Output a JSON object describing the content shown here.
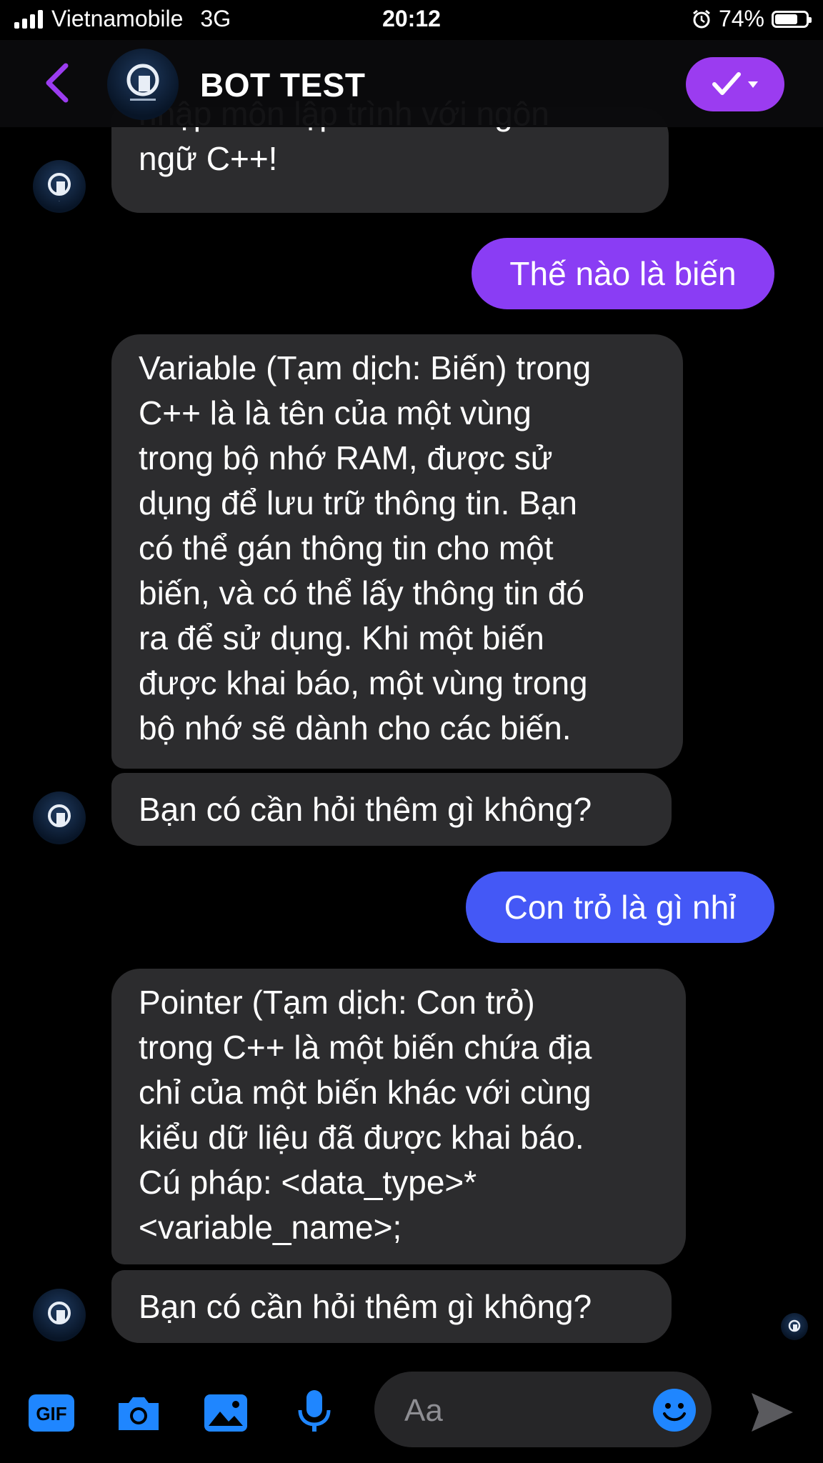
{
  "status_bar": {
    "carrier": "Vietnamobile",
    "network": "3G",
    "time": "20:12",
    "battery": "74%",
    "battery_level": 0.74
  },
  "header": {
    "title": "BOT TEST"
  },
  "messages": [
    {
      "from": "bot",
      "text": "nhập môn lập trình với ngôn"
    },
    {
      "from": "bot",
      "text": "ngữ C++!"
    },
    {
      "from": "user",
      "text": "Thế nào là biến"
    },
    {
      "from": "bot",
      "lines": [
        "Variable (Tạm dịch: Biến) trong",
        "C++ là là tên của một vùng",
        "trong bộ nhớ RAM, được sử",
        "dụng để lưu trữ thông tin. Bạn",
        "có thể gán thông tin cho một",
        "biến, và có thể lấy thông tin đó",
        "ra để sử dụng. Khi một biến",
        "được khai báo, một vùng trong",
        "bộ nhớ sẽ dành cho các biến."
      ]
    },
    {
      "from": "bot",
      "text": "Bạn có cần hỏi thêm gì không?"
    },
    {
      "from": "user",
      "text": "Con trỏ là gì nhỉ"
    },
    {
      "from": "bot",
      "lines": [
        "Pointer (Tạm dịch: Con trỏ)",
        "trong C++ là một biến chứa địa",
        "chỉ của một biến khác với cùng",
        "kiểu dữ liệu đã được khai báo.",
        "Cú pháp: <data_type>*",
        "<variable_name>;"
      ]
    },
    {
      "from": "bot",
      "text": "Bạn có cần hỏi thêm gì không?"
    }
  ],
  "composer": {
    "placeholder": "Aa",
    "gif_label": "GIF"
  },
  "colors": {
    "accent_purple": "#9b3cf0",
    "user_bubble_1": "#8a3df4",
    "user_bubble_2": "#4458f6",
    "bot_bubble": "#2c2c2e",
    "tool_blue": "#1f86ff"
  },
  "icons": [
    "signal-icon",
    "alarm-icon",
    "battery-icon",
    "back-arrow-icon",
    "bot-avatar",
    "checkmark-dropdown-icon",
    "gif-icon",
    "camera-icon",
    "image-icon",
    "microphone-icon",
    "emoji-icon",
    "send-icon"
  ]
}
